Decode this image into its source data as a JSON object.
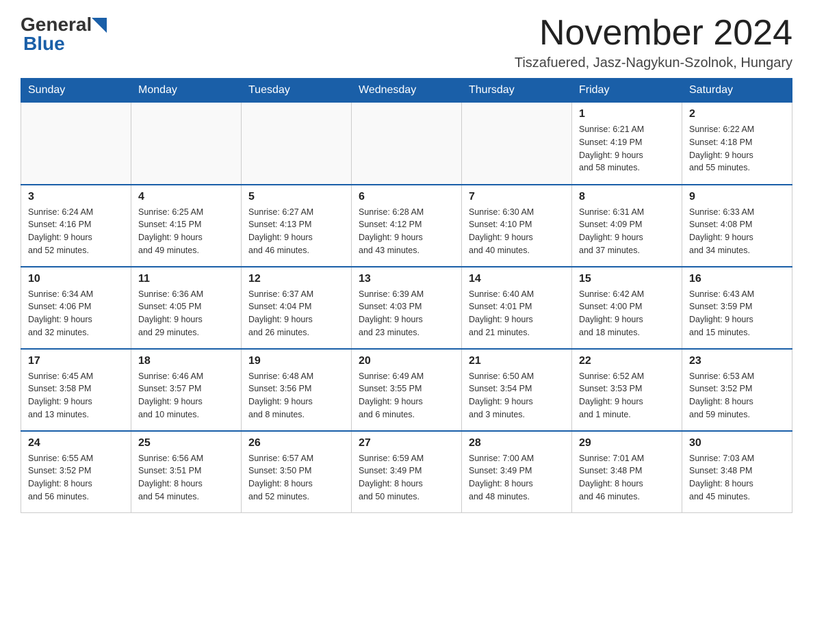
{
  "header": {
    "logo_general": "General",
    "logo_blue": "Blue",
    "month_title": "November 2024",
    "location": "Tiszafuered, Jasz-Nagykun-Szolnok, Hungary"
  },
  "weekdays": [
    "Sunday",
    "Monday",
    "Tuesday",
    "Wednesday",
    "Thursday",
    "Friday",
    "Saturday"
  ],
  "weeks": [
    [
      {
        "day": "",
        "info": ""
      },
      {
        "day": "",
        "info": ""
      },
      {
        "day": "",
        "info": ""
      },
      {
        "day": "",
        "info": ""
      },
      {
        "day": "",
        "info": ""
      },
      {
        "day": "1",
        "info": "Sunrise: 6:21 AM\nSunset: 4:19 PM\nDaylight: 9 hours\nand 58 minutes."
      },
      {
        "day": "2",
        "info": "Sunrise: 6:22 AM\nSunset: 4:18 PM\nDaylight: 9 hours\nand 55 minutes."
      }
    ],
    [
      {
        "day": "3",
        "info": "Sunrise: 6:24 AM\nSunset: 4:16 PM\nDaylight: 9 hours\nand 52 minutes."
      },
      {
        "day": "4",
        "info": "Sunrise: 6:25 AM\nSunset: 4:15 PM\nDaylight: 9 hours\nand 49 minutes."
      },
      {
        "day": "5",
        "info": "Sunrise: 6:27 AM\nSunset: 4:13 PM\nDaylight: 9 hours\nand 46 minutes."
      },
      {
        "day": "6",
        "info": "Sunrise: 6:28 AM\nSunset: 4:12 PM\nDaylight: 9 hours\nand 43 minutes."
      },
      {
        "day": "7",
        "info": "Sunrise: 6:30 AM\nSunset: 4:10 PM\nDaylight: 9 hours\nand 40 minutes."
      },
      {
        "day": "8",
        "info": "Sunrise: 6:31 AM\nSunset: 4:09 PM\nDaylight: 9 hours\nand 37 minutes."
      },
      {
        "day": "9",
        "info": "Sunrise: 6:33 AM\nSunset: 4:08 PM\nDaylight: 9 hours\nand 34 minutes."
      }
    ],
    [
      {
        "day": "10",
        "info": "Sunrise: 6:34 AM\nSunset: 4:06 PM\nDaylight: 9 hours\nand 32 minutes."
      },
      {
        "day": "11",
        "info": "Sunrise: 6:36 AM\nSunset: 4:05 PM\nDaylight: 9 hours\nand 29 minutes."
      },
      {
        "day": "12",
        "info": "Sunrise: 6:37 AM\nSunset: 4:04 PM\nDaylight: 9 hours\nand 26 minutes."
      },
      {
        "day": "13",
        "info": "Sunrise: 6:39 AM\nSunset: 4:03 PM\nDaylight: 9 hours\nand 23 minutes."
      },
      {
        "day": "14",
        "info": "Sunrise: 6:40 AM\nSunset: 4:01 PM\nDaylight: 9 hours\nand 21 minutes."
      },
      {
        "day": "15",
        "info": "Sunrise: 6:42 AM\nSunset: 4:00 PM\nDaylight: 9 hours\nand 18 minutes."
      },
      {
        "day": "16",
        "info": "Sunrise: 6:43 AM\nSunset: 3:59 PM\nDaylight: 9 hours\nand 15 minutes."
      }
    ],
    [
      {
        "day": "17",
        "info": "Sunrise: 6:45 AM\nSunset: 3:58 PM\nDaylight: 9 hours\nand 13 minutes."
      },
      {
        "day": "18",
        "info": "Sunrise: 6:46 AM\nSunset: 3:57 PM\nDaylight: 9 hours\nand 10 minutes."
      },
      {
        "day": "19",
        "info": "Sunrise: 6:48 AM\nSunset: 3:56 PM\nDaylight: 9 hours\nand 8 minutes."
      },
      {
        "day": "20",
        "info": "Sunrise: 6:49 AM\nSunset: 3:55 PM\nDaylight: 9 hours\nand 6 minutes."
      },
      {
        "day": "21",
        "info": "Sunrise: 6:50 AM\nSunset: 3:54 PM\nDaylight: 9 hours\nand 3 minutes."
      },
      {
        "day": "22",
        "info": "Sunrise: 6:52 AM\nSunset: 3:53 PM\nDaylight: 9 hours\nand 1 minute."
      },
      {
        "day": "23",
        "info": "Sunrise: 6:53 AM\nSunset: 3:52 PM\nDaylight: 8 hours\nand 59 minutes."
      }
    ],
    [
      {
        "day": "24",
        "info": "Sunrise: 6:55 AM\nSunset: 3:52 PM\nDaylight: 8 hours\nand 56 minutes."
      },
      {
        "day": "25",
        "info": "Sunrise: 6:56 AM\nSunset: 3:51 PM\nDaylight: 8 hours\nand 54 minutes."
      },
      {
        "day": "26",
        "info": "Sunrise: 6:57 AM\nSunset: 3:50 PM\nDaylight: 8 hours\nand 52 minutes."
      },
      {
        "day": "27",
        "info": "Sunrise: 6:59 AM\nSunset: 3:49 PM\nDaylight: 8 hours\nand 50 minutes."
      },
      {
        "day": "28",
        "info": "Sunrise: 7:00 AM\nSunset: 3:49 PM\nDaylight: 8 hours\nand 48 minutes."
      },
      {
        "day": "29",
        "info": "Sunrise: 7:01 AM\nSunset: 3:48 PM\nDaylight: 8 hours\nand 46 minutes."
      },
      {
        "day": "30",
        "info": "Sunrise: 7:03 AM\nSunset: 3:48 PM\nDaylight: 8 hours\nand 45 minutes."
      }
    ]
  ]
}
